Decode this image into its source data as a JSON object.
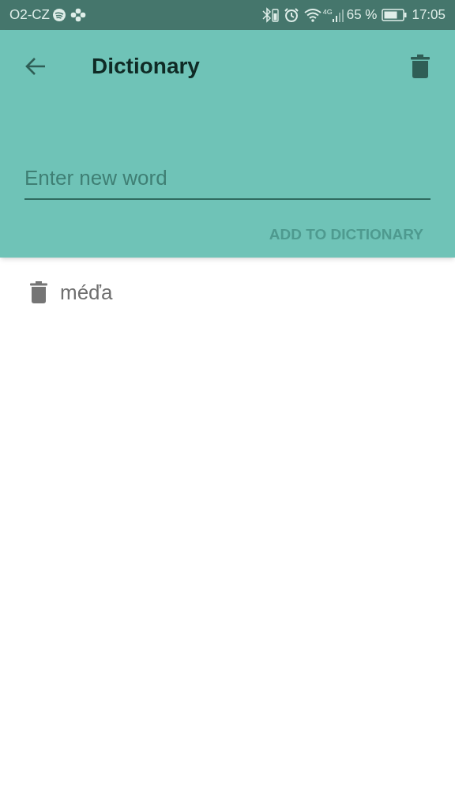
{
  "status_bar": {
    "carrier": "O2-CZ",
    "battery_text": "65 %",
    "time": "17:05",
    "network": "4G"
  },
  "toolbar": {
    "title": "Dictionary"
  },
  "word_field": {
    "placeholder": "Enter new word"
  },
  "add_button": {
    "label": "ADD TO DICTIONARY",
    "disabled": true
  },
  "words": [
    {
      "word": "méďa"
    }
  ]
}
